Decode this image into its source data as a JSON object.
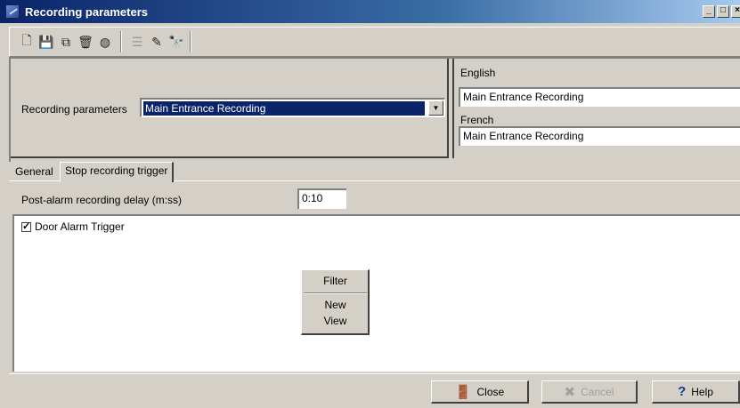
{
  "window": {
    "title": "Recording parameters",
    "controls": {
      "minimize": "_",
      "maximize": "□",
      "close": "×"
    }
  },
  "toolbar": {
    "buttons": [
      {
        "icon": "new-document-icon",
        "glyph": "🗋",
        "enabled": true
      },
      {
        "icon": "save-icon",
        "glyph": "💾",
        "enabled": false
      },
      {
        "icon": "copy-icon",
        "glyph": "⧉",
        "enabled": true
      },
      {
        "icon": "delete-icon",
        "glyph": "🗑",
        "enabled": true
      },
      {
        "icon": "clear-icon",
        "glyph": "◍",
        "enabled": true
      },
      {
        "icon": "list-icon",
        "glyph": "☰",
        "enabled": false
      },
      {
        "icon": "link-icon",
        "glyph": "✎",
        "enabled": true
      },
      {
        "icon": "find-icon",
        "glyph": "🔭",
        "enabled": true
      }
    ]
  },
  "header": {
    "recording_parameters_label": "Recording parameters",
    "recording_parameters_value": "Main Entrance Recording",
    "english_label": "English",
    "english_value": "Main Entrance Recording",
    "french_label": "French",
    "french_value": "Main Entrance Recording"
  },
  "tabs": [
    {
      "label": "General",
      "active": false
    },
    {
      "label": "Stop recording trigger",
      "active": true
    }
  ],
  "stop_trigger": {
    "delay_label": "Post-alarm recording delay (m:ss)",
    "delay_value": "0:10",
    "items": [
      {
        "label": "Door Alarm Trigger",
        "checked": true
      }
    ]
  },
  "context_menu": {
    "items": [
      "Filter",
      "New",
      "View"
    ]
  },
  "footer": {
    "close_label": "Close",
    "cancel_label": "Cancel",
    "help_label": "Help",
    "cancel_enabled": false
  },
  "colors": {
    "titlebar_start": "#0a246a",
    "titlebar_end": "#a6caf0",
    "selection": "#0a246a",
    "surface": "#d4d0c8"
  }
}
